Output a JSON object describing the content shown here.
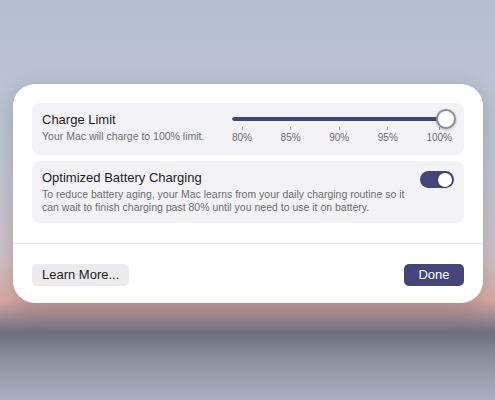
{
  "charge_limit": {
    "title": "Charge Limit",
    "description": "Your Mac will charge to 100% limit.",
    "level": 1,
    "ticks": [
      "80%",
      "85%",
      "90%",
      "95%",
      "100%"
    ]
  },
  "optimized_charging": {
    "title": "Optimized Battery Charging",
    "description": "To reduce battery aging, your Mac learns from your daily charging routine so it can wait to finish charging past 80% until you need to use it on battery.",
    "on": true
  },
  "buttons": [
    {
      "label": "Learn More...",
      "primary": false
    },
    {
      "label": "Done",
      "primary": true
    }
  ]
}
